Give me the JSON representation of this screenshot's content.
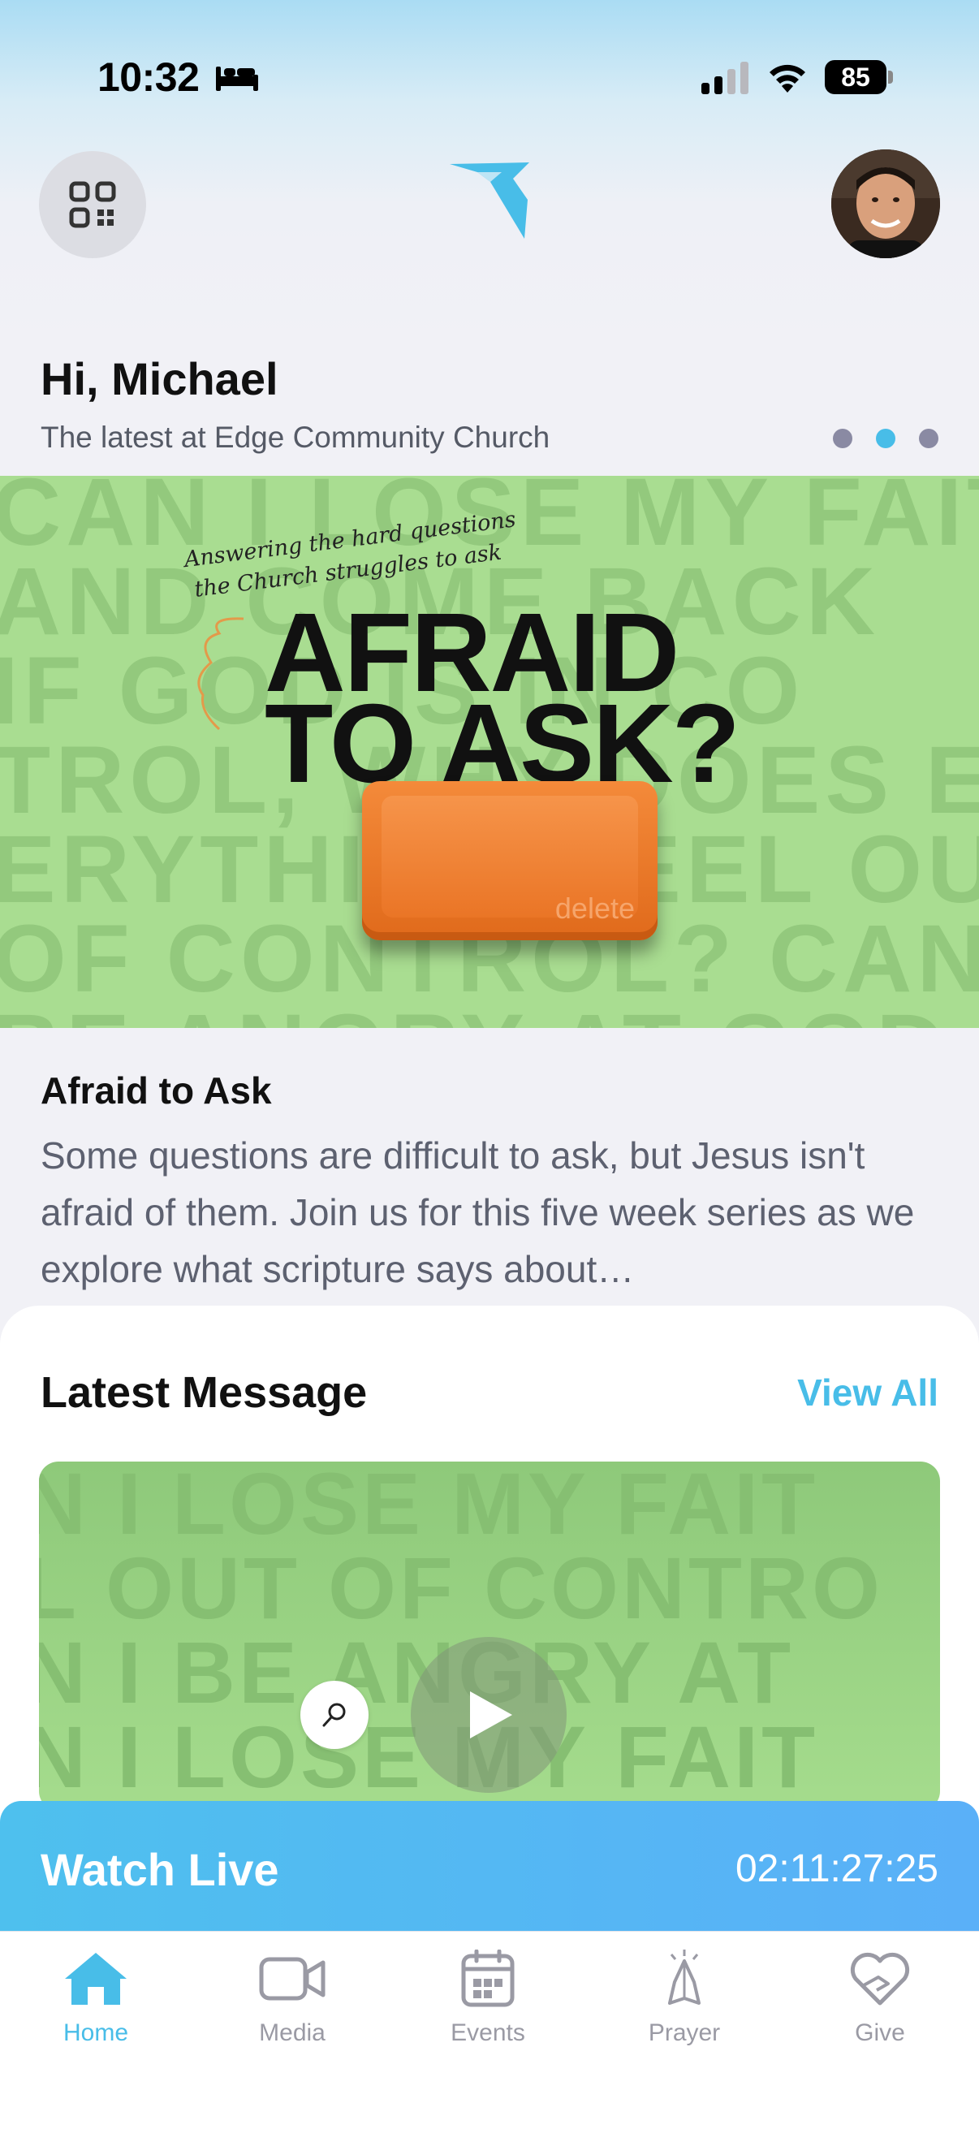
{
  "status_bar": {
    "time": "10:32",
    "battery": "85"
  },
  "header": {
    "greeting": "Hi, Michael",
    "subtitle": "The latest at Edge Community Church"
  },
  "carousel": {
    "active_index": 1,
    "count": 3
  },
  "banner": {
    "handwriting_line1": "Answering the hard questions",
    "handwriting_line2": "the Church struggles to ask",
    "title_line1": "AFRAID",
    "title_line2": "TO ASK?",
    "key_label": "delete",
    "background_lines": [
      "CAN I LOSE MY FAITH",
      "AND COME BACK",
      "IF GOD IS IN CO",
      "TROL, WHY DOES EV",
      "ERYTHING FEEL OU",
      "OF CONTROL? CAN",
      "BE ANGRY AT GOD"
    ]
  },
  "feature": {
    "title": "Afraid to Ask",
    "description": "Some questions are difficult to ask, but Jesus isn't afraid of them. Join us for this five week series as we explore what scripture says about…"
  },
  "latest_message": {
    "title": "Latest Message",
    "view_all": "View All",
    "background_lines": [
      "N I LOSE MY FAIT",
      "L OUT OF CONTRO",
      "N I BE ANGRY AT",
      "N I LOSE MY FAIT"
    ]
  },
  "watch_live": {
    "label": "Watch Live",
    "countdown": "02:11:27:25"
  },
  "tabs": [
    {
      "label": "Home",
      "icon": "home-icon",
      "active": true
    },
    {
      "label": "Media",
      "icon": "video-camera-icon",
      "active": false
    },
    {
      "label": "Events",
      "icon": "calendar-icon",
      "active": false
    },
    {
      "label": "Prayer",
      "icon": "praying-hands-icon",
      "active": false
    },
    {
      "label": "Give",
      "icon": "heart-hand-icon",
      "active": false
    }
  ],
  "colors": {
    "accent": "#48bde8",
    "banner_green": "#a9dd91",
    "key_orange": "#e06a1b",
    "inactive": "#9a9aa4"
  }
}
